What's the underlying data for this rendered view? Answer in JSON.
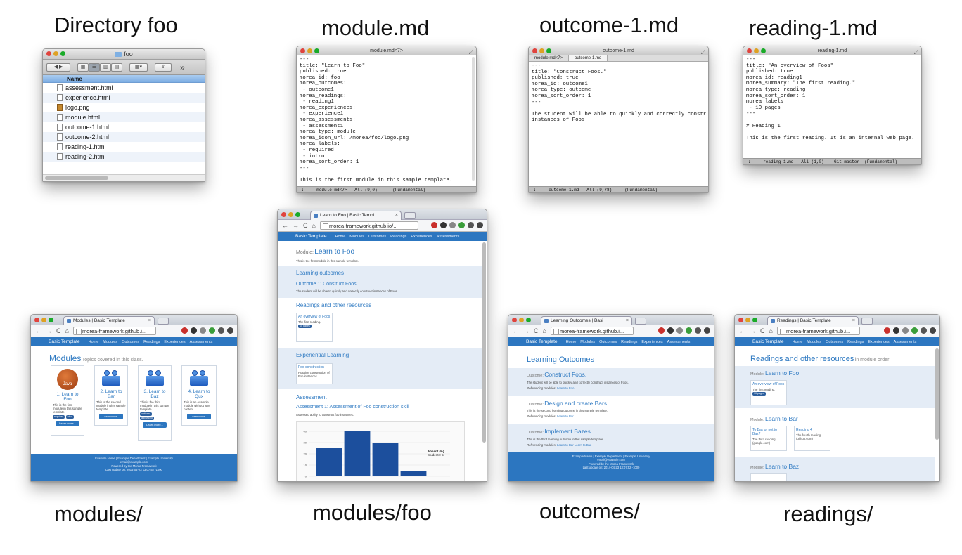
{
  "captions": {
    "directory": "Directory foo",
    "module_md": "module.md",
    "outcome_md": "outcome-1.md",
    "reading_md": "reading-1.md",
    "modules": "modules/",
    "modules_foo": "modules/foo",
    "outcomes": "outcomes/",
    "readings": "readings/"
  },
  "finder": {
    "title": "foo",
    "column_header": "Name",
    "files": [
      "assessment.html",
      "experience.html",
      "logo.png",
      "module.html",
      "outcome-1.html",
      "outcome-2.html",
      "reading-1.html",
      "reading-2.html"
    ],
    "more": "»"
  },
  "module_md": {
    "title": "module.md<7>",
    "lines": "---\ntitle: \"Learn to Foo\"\npublished: true\nmorea_id: foo\nmorea_outcomes:\n - outcome1\nmorea_readings:\n - reading1\nmorea_experiences:\n - experience1\nmorea_assessments:\n - assessment1\nmorea_type: module\nmorea_icon_url: /morea/foo/logo.png\nmorea_labels:\n - required\n - intro\nmorea_sort_order: 1\n---\n\nThis is the first module in this sample template.",
    "modeline": "-:---  module.md<7>   All (9,0)      (Fundamental)"
  },
  "outcome_md": {
    "title": "outcome-1.md",
    "tab1": "module.md<7>",
    "tab2": "outcome-1.md",
    "lines": "---\ntitle: \"Construct Foos.\"\npublished: true\nmorea_id: outcome1\nmorea_type: outcome\nmorea_sort_order: 1\n---\n\nThe student will be able to quickly and correctly construct\ninstances of Foos.",
    "modeline": "-:---  outcome-1.md   All (9,78)     (Fundamental)"
  },
  "reading_md": {
    "title": "reading-1.md",
    "lines": "---\ntitle: \"An overview of Foos\"\npublished: true\nmorea_id: reading1\nmorea_summary: \"The first reading.\"\nmorea_type: reading\nmorea_sort_order: 1\nmorea_labels:\n - 10 pages\n---\n\n# Reading 1\n\nThis is the first reading. It is an internal web page.",
    "modeline": "-:---  reading-1.md   All (1,0)    Git-master  (Fundamental)"
  },
  "nav": {
    "brand": "Basic Template",
    "items": [
      "Home",
      "Modules",
      "Outcomes",
      "Readings",
      "Experiences",
      "Assessments"
    ]
  },
  "modules_page": {
    "tab": "Modules | Basic Template",
    "url": "morea-framework.github.i...",
    "heading": "Modules",
    "heading_sub": "Topics covered in this class.",
    "cards": [
      {
        "title": "1. Learn to Foo",
        "desc": "This is the first module in this sample template.",
        "badges": [
          "required",
          "intro"
        ],
        "button": "Learn more..."
      },
      {
        "title": "2. Learn to Bar",
        "desc": "This is the second module in this sample template.",
        "badges": [],
        "button": "Learn more..."
      },
      {
        "title": "3. Learn to Baz",
        "desc": "This is the third module in this sample template.",
        "badges": [
          "optional",
          "advanced"
        ],
        "button": "Learn more..."
      },
      {
        "title": "4. Learn to Qux",
        "desc": "This is an example module without any content.",
        "badges": [],
        "button": "Learn more..."
      }
    ],
    "java_label": "Java"
  },
  "foo_page": {
    "tab": "Learn to Foo | Basic Templ",
    "url": "morea-framework.github.io/...",
    "module_label": "Module:",
    "module_title": "Learn to Foo",
    "module_desc": "This is the first module in this sample template.",
    "outcomes_heading": "Learning outcomes",
    "outcome_title": "Outcome 1: Construct Foos.",
    "outcome_desc": "The student will be able to quickly and correctly construct instances of Foos.",
    "readings_heading": "Readings and other resources",
    "reading_title": "An overview of Foos",
    "reading_desc": "The first reading.",
    "reading_badge": "10 pages",
    "exp_heading": "Experiential Learning",
    "exp_title": "Foo construction",
    "exp_desc": "Practice construction of Foo instances.",
    "assess_heading": "Assessment",
    "assess_title": "Assessment 1: Assessment of Foo construction skill",
    "assess_desc": "Assessed ability to construct foo instances.",
    "legend_label": "Absent (%)",
    "legend_students": "Students: 5"
  },
  "chart_data": {
    "type": "bar",
    "categories": [
      "",
      "",
      "",
      ""
    ],
    "values": [
      25,
      40,
      30,
      5
    ],
    "ylim": [
      0,
      40
    ],
    "yticks": [
      "40",
      "30",
      "20",
      "10",
      "0"
    ],
    "color": "#1c4f9d"
  },
  "outcomes_page": {
    "tab": "Learning Outcomes | Basi",
    "url": "morea-framework.github.i...",
    "heading": "Learning Outcomes",
    "label": "Outcome:",
    "ref_label": "Referencing modules:",
    "items": [
      {
        "title": "Construct Foos.",
        "desc": "The student will be able to quickly and correctly construct instances of Foos.",
        "refs": "Learn to Foo"
      },
      {
        "title": "Design and create Bars",
        "desc": "This is the second learning outcome in this sample template.",
        "refs": "Learn to Bar"
      },
      {
        "title": "Implement Bazes",
        "desc": "This is the third learning outcome in this sample template.",
        "refs": "Learn to Bar Learn to Baz"
      }
    ]
  },
  "readings_page": {
    "tab": "Readings | Basic Template",
    "url": "morea-framework.github.i...",
    "heading": "Readings and other resources",
    "heading_sub": "in module order",
    "module_label": "Module:",
    "m1": "Learn to Foo",
    "m1_reading_title": "An overview of Foos",
    "m1_reading_desc": "The first reading.",
    "m1_badge": "10 pages",
    "m2": "Learn to Bar",
    "m2_r1_title": "To Baz or not to Baz?",
    "m2_r1_desc": "The third reading. (google.com)",
    "m2_r2_title": "Reading 4",
    "m2_r2_desc": "The fourth reading (github.com)",
    "m3": "Learn to Baz"
  },
  "footer": {
    "line1": "Example Name | Example Department | Example University",
    "line2": "email@example.com",
    "line3": "Powered by the Morea Framework",
    "line4": "Last update on: 2014-04-23 13:07:52 -1000"
  }
}
